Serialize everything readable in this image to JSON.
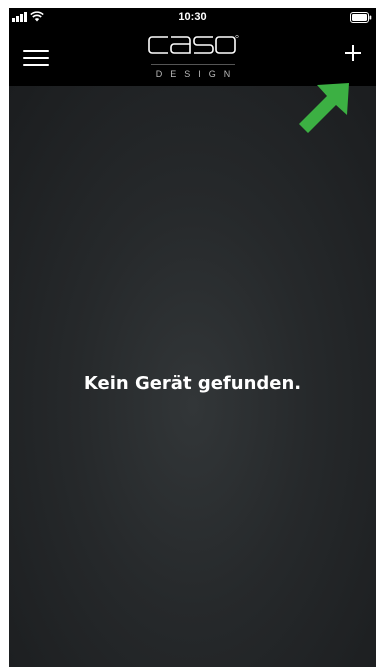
{
  "status_bar": {
    "time": "10:30",
    "signal_icon": "signal-bars-icon",
    "wifi_icon": "wifi-icon",
    "battery_icon": "battery-icon"
  },
  "header": {
    "menu_icon": "hamburger-menu-icon",
    "logo": {
      "wordmark": "caso",
      "subtitle": "DESIGN"
    },
    "add_icon": "plus-icon"
  },
  "main": {
    "empty_message": "Kein Gerät gefunden."
  },
  "annotation": {
    "arrow_icon": "green-arrow-icon",
    "arrow_color": "#3cb043"
  },
  "colors": {
    "header_background": "#000000",
    "content_background": "#1b1d1f",
    "text": "#ffffff"
  }
}
